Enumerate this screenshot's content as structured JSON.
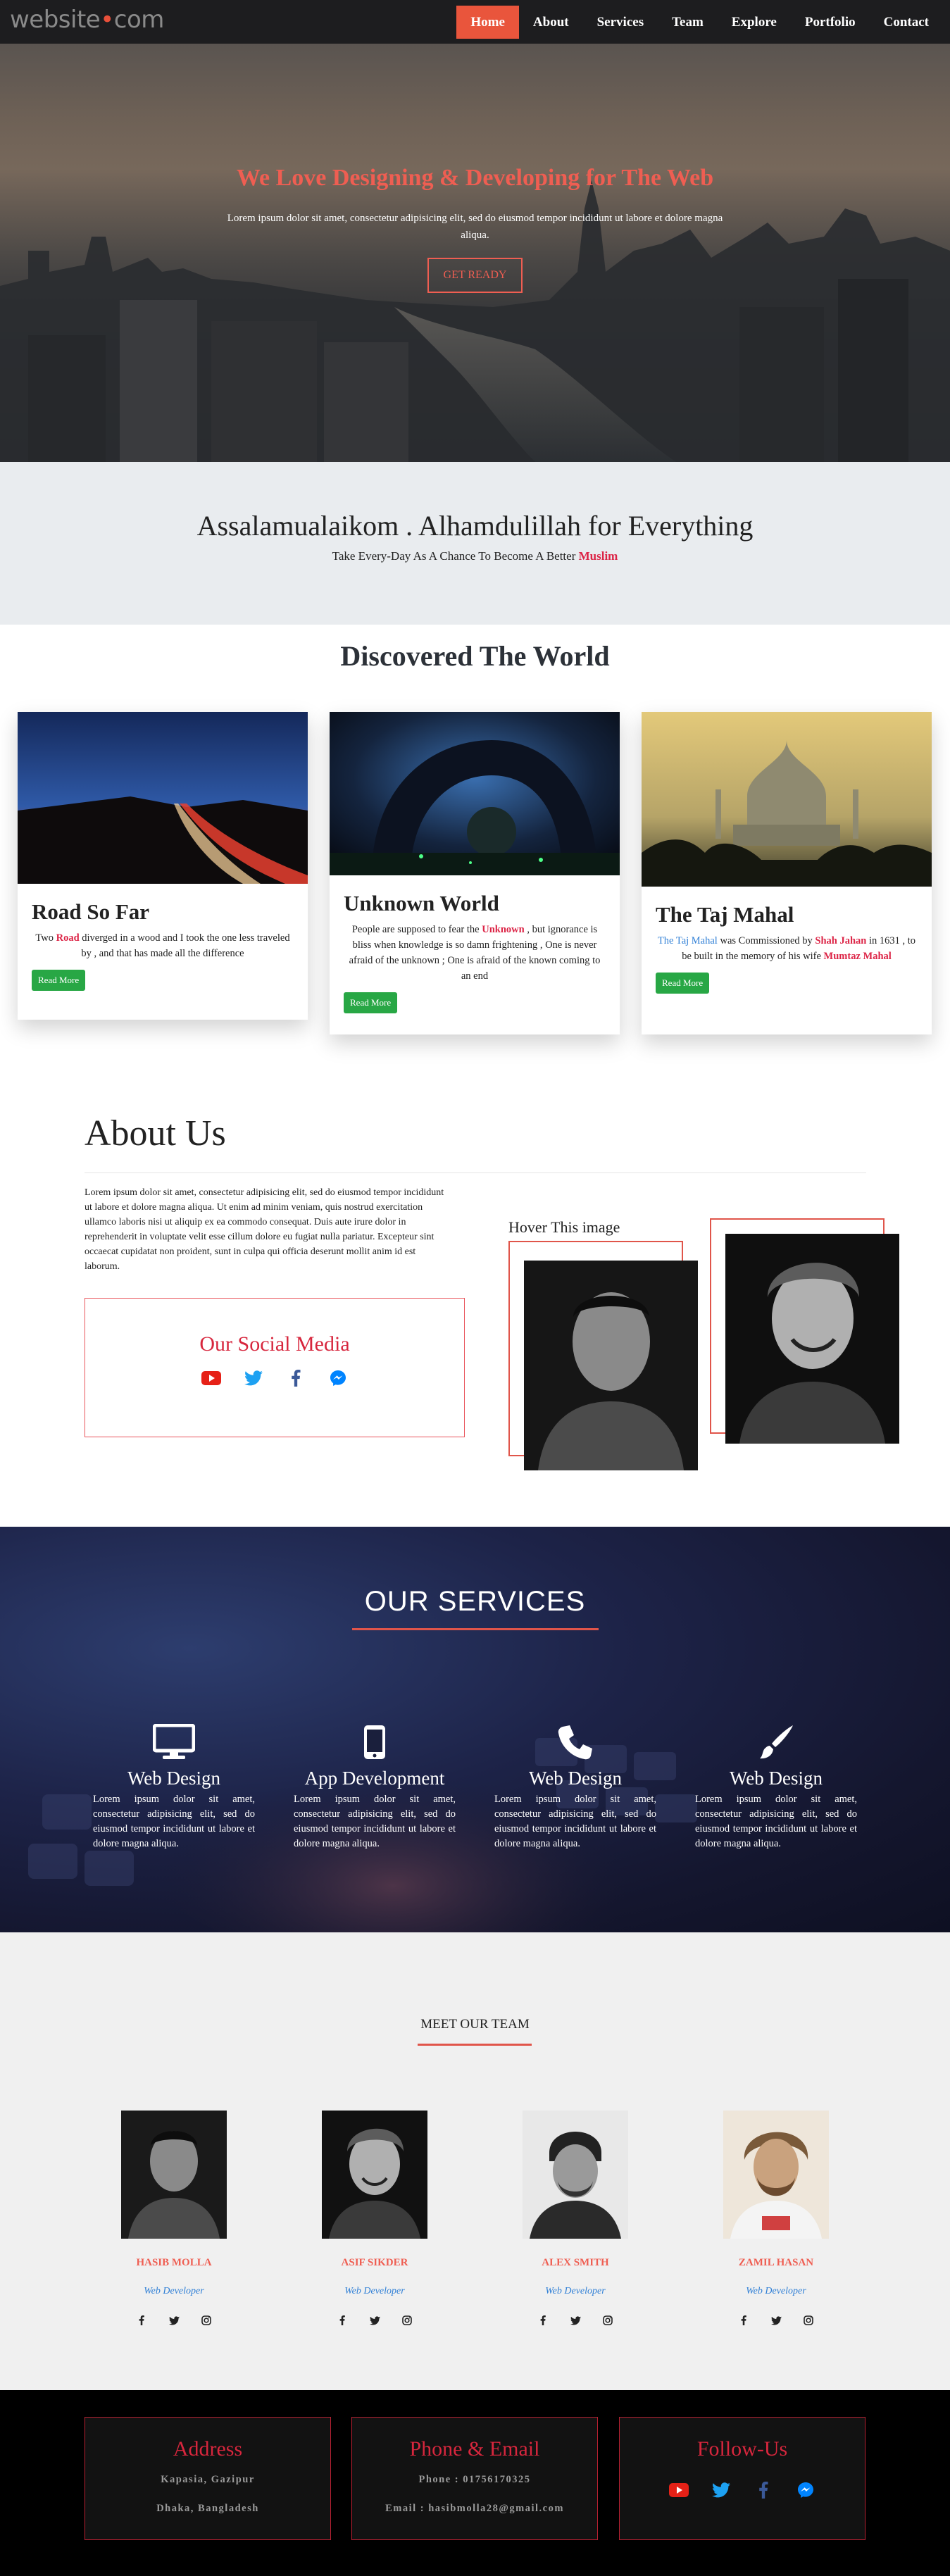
{
  "nav": {
    "logo_main": "website",
    "logo_dot": "•",
    "logo_tld": "com",
    "links": [
      "Home",
      "About",
      "Services",
      "Team",
      "Explore",
      "Portfolio",
      "Contact"
    ],
    "active": "Home"
  },
  "hero": {
    "title": "We Love Designing & Developing for The Web",
    "subtitle": "Lorem ipsum dolor sit amet, consectetur adipisicing elit, sed do eiusmod tempor incididunt ut labore et dolore magna aliqua.",
    "button": "GET READY"
  },
  "greeting": {
    "title": "Assalamualaikom . Alhamdulillah for Everything",
    "subtitle_prefix": "Take Every-Day As A Chance To Become A Better ",
    "subtitle_accent": "Muslim"
  },
  "discover": {
    "title": "Discovered The World",
    "cards": [
      {
        "title": "Road So Far",
        "text_a": "Two ",
        "text_red": "Road",
        "text_b": " diverged in a wood and I took the one less traveled by , and that has made all the difference",
        "button": "Read More"
      },
      {
        "title": "Unknown World",
        "text_a": "People are supposed to fear the ",
        "text_red": "Unknown",
        "text_b": " , but ignorance is bliss when knowledge is so damn frightening , One is never afraid of the unknown ; One is afraid of the known coming to an end",
        "button": "Read More"
      },
      {
        "title": "The Taj Mahal",
        "text_blue": "The Taj Mahal",
        "text_a": " was Commissioned by ",
        "text_red": "Shah Jahan",
        "text_b": " in 1631 , to be built in the memory of his wife ",
        "text_red2": "Mumtaz Mahal",
        "button": "Read More"
      }
    ]
  },
  "about": {
    "title": "About Us",
    "text": "Lorem ipsum dolor sit amet, consectetur adipisicing elit, sed do eiusmod tempor incididunt ut labore et dolore magna aliqua. Ut enim ad minim veniam, quis nostrud exercitation ullamco laboris nisi ut aliquip ex ea commodo consequat. Duis aute irure dolor in reprehenderit in voluptate velit esse cillum dolore eu fugiat nulla pariatur. Excepteur sint occaecat cupidatat non proident, sunt in culpa qui officia deserunt mollit anim id est laborum.",
    "social_title": "Our Social Media",
    "hover_label": "Hover This image",
    "social_icons": [
      "youtube-icon",
      "twitter-icon",
      "facebook-icon",
      "messenger-icon"
    ]
  },
  "services": {
    "title": "OUR SERVICES",
    "items": [
      {
        "icon": "desktop-icon",
        "title": "Web Design",
        "text": "Lorem ipsum dolor sit amet, consectetur adipisicing elit, sed do eiusmod tempor incididunt ut labore et dolore magna aliqua."
      },
      {
        "icon": "mobile-icon",
        "title": "App Development",
        "text": "Lorem ipsum dolor sit amet, consectetur adipisicing elit, sed do eiusmod tempor incididunt ut labore et dolore magna aliqua."
      },
      {
        "icon": "phone-icon",
        "title": "Web Design",
        "text": "Lorem ipsum dolor sit amet, consectetur adipisicing elit, sed do eiusmod tempor incididunt ut labore et dolore magna aliqua."
      },
      {
        "icon": "paintbrush-icon",
        "title": "Web Design",
        "text": "Lorem ipsum dolor sit amet, consectetur adipisicing elit, sed do eiusmod tempor incididunt ut labore et dolore magna aliqua."
      }
    ]
  },
  "team": {
    "title": "MEET OUR TEAM",
    "members": [
      {
        "name": "HASIB MOLLA",
        "role": "Web Developer"
      },
      {
        "name": "ASIF SIKDER",
        "role": "Web Developer"
      },
      {
        "name": "ALEX SMITH",
        "role": "Web Developer"
      },
      {
        "name": "ZAMIL HASAN",
        "role": "Web Developer"
      }
    ],
    "member_icons": [
      "facebook-icon",
      "twitter-icon",
      "instagram-icon"
    ]
  },
  "footer": {
    "address_title": "Address",
    "address_line1": "Kapasia, Gazipur",
    "address_line2": "Dhaka, Bangladesh",
    "contact_title": "Phone & Email",
    "phone": "Phone : 01756170325",
    "email": "Email : hasibmolla28@gmail.com",
    "follow_title": "Follow-Us"
  },
  "colors": {
    "accent": "#e9553c",
    "heading_red": "#d7263d",
    "link_blue": "#2f7fd6",
    "button_green": "#28a745",
    "nav_bg": "#1d1d1f"
  }
}
